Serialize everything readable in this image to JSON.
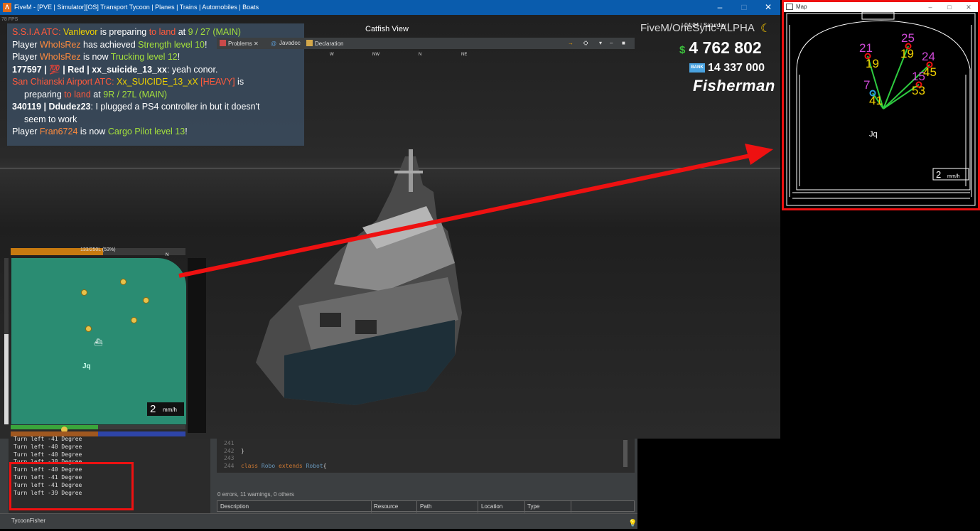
{
  "game_window": {
    "title": "FiveM - [PVE | Simulator][OS] Transport Tycoon | Planes | Trains | Automobiles | Boats",
    "app_icon": "fivem-icon",
    "fps": "78 FPS"
  },
  "chat": {
    "lines": [
      {
        "parts": [
          [
            "S.S.I.A ATC: ",
            "red"
          ],
          [
            "Vanlevor",
            "yellow"
          ],
          [
            " is preparing ",
            "white"
          ],
          [
            "to land",
            "red"
          ],
          [
            " at ",
            "white"
          ],
          [
            "9 / 27 (MAIN)",
            "green"
          ]
        ]
      },
      {
        "parts": [
          [
            "Player ",
            "white"
          ],
          [
            "WhoIsRez",
            "orange"
          ],
          [
            " has achieved ",
            "white"
          ],
          [
            "Strength level 10",
            "green"
          ],
          [
            "!",
            "white"
          ]
        ]
      },
      {
        "parts": [
          [
            "Player ",
            "white"
          ],
          [
            "WhoIsRez",
            "orange"
          ],
          [
            " is now ",
            "white"
          ],
          [
            "Trucking level 12",
            "green"
          ],
          [
            "!",
            "white"
          ]
        ]
      },
      {
        "parts": [
          [
            "177597 | ",
            "bold"
          ],
          [
            "💯",
            "white"
          ],
          [
            " | Red | xx_suicide_13_xx",
            "bold"
          ],
          [
            ": yeah conor.",
            "white"
          ]
        ]
      },
      {
        "parts": [
          [
            "San Chianski Airport ATC: ",
            "red"
          ],
          [
            "Xx_SUICIDE_13_xX",
            "yellow"
          ],
          [
            " [HEAVY]",
            "red"
          ],
          [
            " is",
            "white"
          ]
        ]
      },
      {
        "parts": [
          [
            "preparing ",
            "white"
          ],
          [
            "to land",
            "red"
          ],
          [
            " at ",
            "white"
          ],
          [
            "9R / 27L (MAIN)",
            "green"
          ]
        ],
        "indent": true
      },
      {
        "parts": [
          [
            "340119 | Ddudez23",
            "bold"
          ],
          [
            ": I plugged a PS4 controller in but it doesn't",
            "white"
          ]
        ]
      },
      {
        "parts": [
          [
            "seem to work",
            "white"
          ]
        ],
        "indent": true
      },
      {
        "parts": [
          [
            "Player ",
            "white"
          ],
          [
            "Fran6724",
            "orange"
          ],
          [
            " is now ",
            "white"
          ],
          [
            "Cargo Pilot level 13",
            "green"
          ],
          [
            "!",
            "white"
          ]
        ]
      }
    ]
  },
  "compass": {
    "label": "Catfish View",
    "directions": [
      "W",
      "NW",
      "N",
      "NE"
    ]
  },
  "hud": {
    "server": "FiveM/OneSync-ALPHA",
    "clock": "| 04:04 | Saturday |",
    "cash_symbol": "$",
    "cash": "4 762 802",
    "bank_label": "BANK",
    "bank": "14 337 000",
    "job": "Fisherman",
    "moon_icon": "moon-icon"
  },
  "minimap": {
    "fuel_text": "133/250L (53%)",
    "fuel_fraction": 0.53,
    "north": "N",
    "speed": "2",
    "speed_unit": "mm/h",
    "player_icon": "boat-icon",
    "jq_label": "Jq",
    "health_fraction": 0.5,
    "armor_fraction": 0.5
  },
  "map_window": {
    "title": "Map",
    "labels": [
      "21",
      "19",
      "25",
      "19",
      "24",
      "15",
      "45",
      "7",
      "41",
      "53"
    ],
    "speed": "2",
    "speed_unit": "mm/h"
  },
  "console": {
    "lines": [
      "Turn left -41 Degree",
      "Turn left -40 Degree",
      "Turn left -40 Degree",
      "Turn left -38 Degree",
      "Turn left -40 Degree",
      "Turn left -41 Degree",
      "Turn left -41 Degree",
      "Turn left -39 Degree"
    ]
  },
  "editor": {
    "lines": [
      {
        "num": "241",
        "code": ""
      },
      {
        "num": "242",
        "code": "}"
      },
      {
        "num": "243",
        "code": ""
      },
      {
        "num": "244",
        "code": "class Robo extends Robot{"
      }
    ]
  },
  "problems": {
    "tabs": [
      "Problems",
      "Javadoc",
      "Declaration"
    ],
    "summary": "0 errors, 11 warnings, 0 others",
    "columns": [
      "Description",
      "Resource",
      "Path",
      "Location",
      "Type"
    ]
  },
  "status_bar": {
    "text": "TycoonFisher"
  },
  "colors": {
    "title_bar": "#0a5cad",
    "highlight": "#e11111",
    "chat_bg": "#3a4a5c",
    "minimap": "#2a8c72"
  }
}
